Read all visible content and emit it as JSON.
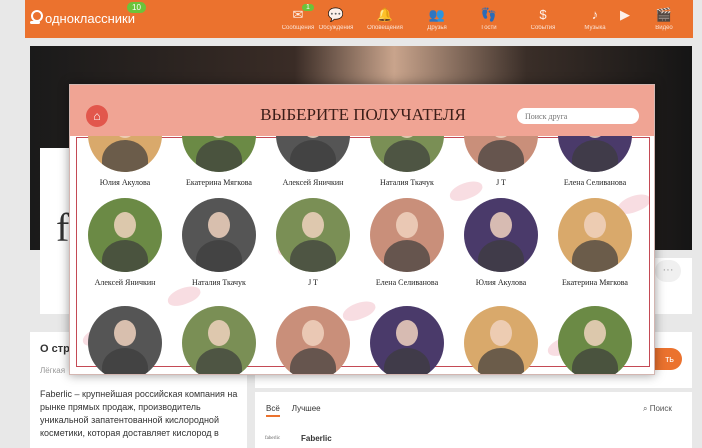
{
  "site": {
    "name": "одноклассники",
    "badge": "10"
  },
  "nav": [
    {
      "label": "Сообщения",
      "icon": "✉",
      "count": "1"
    },
    {
      "label": "Обсуждения",
      "icon": "💬",
      "count": ""
    },
    {
      "label": "Оповещения",
      "icon": "🔔",
      "count": ""
    },
    {
      "label": "Друзья",
      "icon": "👥",
      "count": ""
    },
    {
      "label": "Гости",
      "icon": "👣",
      "count": ""
    },
    {
      "label": "События",
      "icon": "$",
      "count": ""
    },
    {
      "label": "Музыка",
      "icon": "♪",
      "count": ""
    },
    {
      "label": "",
      "icon": "▶",
      "count": ""
    },
    {
      "label": "Видео",
      "icon": "🎬",
      "count": ""
    }
  ],
  "background": {
    "card_initial": "f",
    "more_button": "···",
    "left_title": "О стр",
    "left_subtitle": "Лёгкая",
    "left_description": "Faberlic – крупнейшая российская компания на рынке прямых продаж, производитель уникальной запатентованной кислородной косметики, которая доставляет кислород в",
    "right_button": "ть",
    "tabs": [
      "Всё",
      "Лучшее"
    ],
    "search_label": "Поиск",
    "post_author": "Faberlic",
    "post_logo": "faberlic"
  },
  "modal": {
    "title": "ВЫБЕРИТЕ ПОЛУЧАТЕЛЯ",
    "home_icon": "home-icon",
    "search_placeholder": "Поиск друга",
    "watermark": "faberlic",
    "friends_row1": [
      "Юлия Акулова",
      "Екатерина Мягкова",
      "Алексей Яничкин",
      "Наталия Ткачук",
      "J T",
      "Елена Селиванова"
    ],
    "friends_row2": [
      "Алексей Яничкин",
      "Наталия Ткачук",
      "J T",
      "Елена Селиванова",
      "Юлия Акулова",
      "Екатерина Мягкова"
    ],
    "friends_row3": [
      "",
      "",
      "",
      "",
      "",
      ""
    ]
  },
  "colors": {
    "brand": "#eb722e",
    "modal_header": "#f0a494",
    "accent_red": "#e2574c"
  }
}
